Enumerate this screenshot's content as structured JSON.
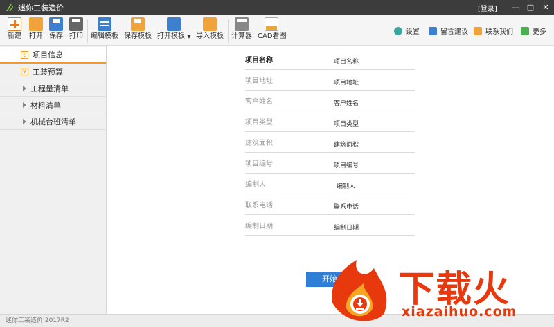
{
  "app": {
    "title": "迷你工装造价",
    "login": "[登录]",
    "window_controls": {
      "minimize": "—",
      "maximize": "□",
      "close": "✕"
    }
  },
  "toolbar": {
    "buttons": [
      {
        "label": "新建",
        "icon": "new-file-icon"
      },
      {
        "label": "打开",
        "icon": "open-folder-icon"
      },
      {
        "label": "保存",
        "icon": "save-icon"
      },
      {
        "label": "打印",
        "icon": "print-icon"
      },
      {
        "label": "编辑模板",
        "icon": "edit-template-icon"
      },
      {
        "label": "保存模板",
        "icon": "save-template-icon"
      },
      {
        "label": "打开模板",
        "icon": "open-template-icon"
      },
      {
        "label": "导入模板",
        "icon": "import-template-icon"
      },
      {
        "label": "计算器",
        "icon": "calculator-icon"
      },
      {
        "label": "CAD看图",
        "icon": "cad-icon"
      }
    ],
    "right": [
      {
        "label": "设置",
        "icon": "gear-icon"
      },
      {
        "label": "留言建议",
        "icon": "feedback-icon"
      },
      {
        "label": "联系我们",
        "icon": "mail-icon"
      },
      {
        "label": "更多",
        "icon": "more-icon"
      }
    ]
  },
  "sidebar": {
    "items": [
      {
        "label": "项目信息",
        "icon": "E"
      },
      {
        "label": "工装预算",
        "icon": "¥"
      },
      {
        "label": "工程量清单"
      },
      {
        "label": "材料清单"
      },
      {
        "label": "机械台班清单"
      }
    ]
  },
  "form": {
    "fields": [
      {
        "label": "项目名称",
        "value": "项目名称"
      },
      {
        "label": "项目地址",
        "value": "项目地址"
      },
      {
        "label": "客户姓名",
        "value": "客户姓名"
      },
      {
        "label": "项目类型",
        "value": "项目类型"
      },
      {
        "label": "建筑面积",
        "value": "建筑面积"
      },
      {
        "label": "项目编号",
        "value": "项目编号"
      },
      {
        "label": "编制人",
        "value": "编制人"
      },
      {
        "label": "联系电话",
        "value": "联系电话"
      },
      {
        "label": "编制日期",
        "value": "编制日期"
      }
    ],
    "start_button": "开始"
  },
  "statusbar": {
    "text": "迷你工装造价  2017R2"
  },
  "watermark": {
    "text": "下载火",
    "url": "xiazaihuo.com",
    "color": "#e8380d"
  }
}
